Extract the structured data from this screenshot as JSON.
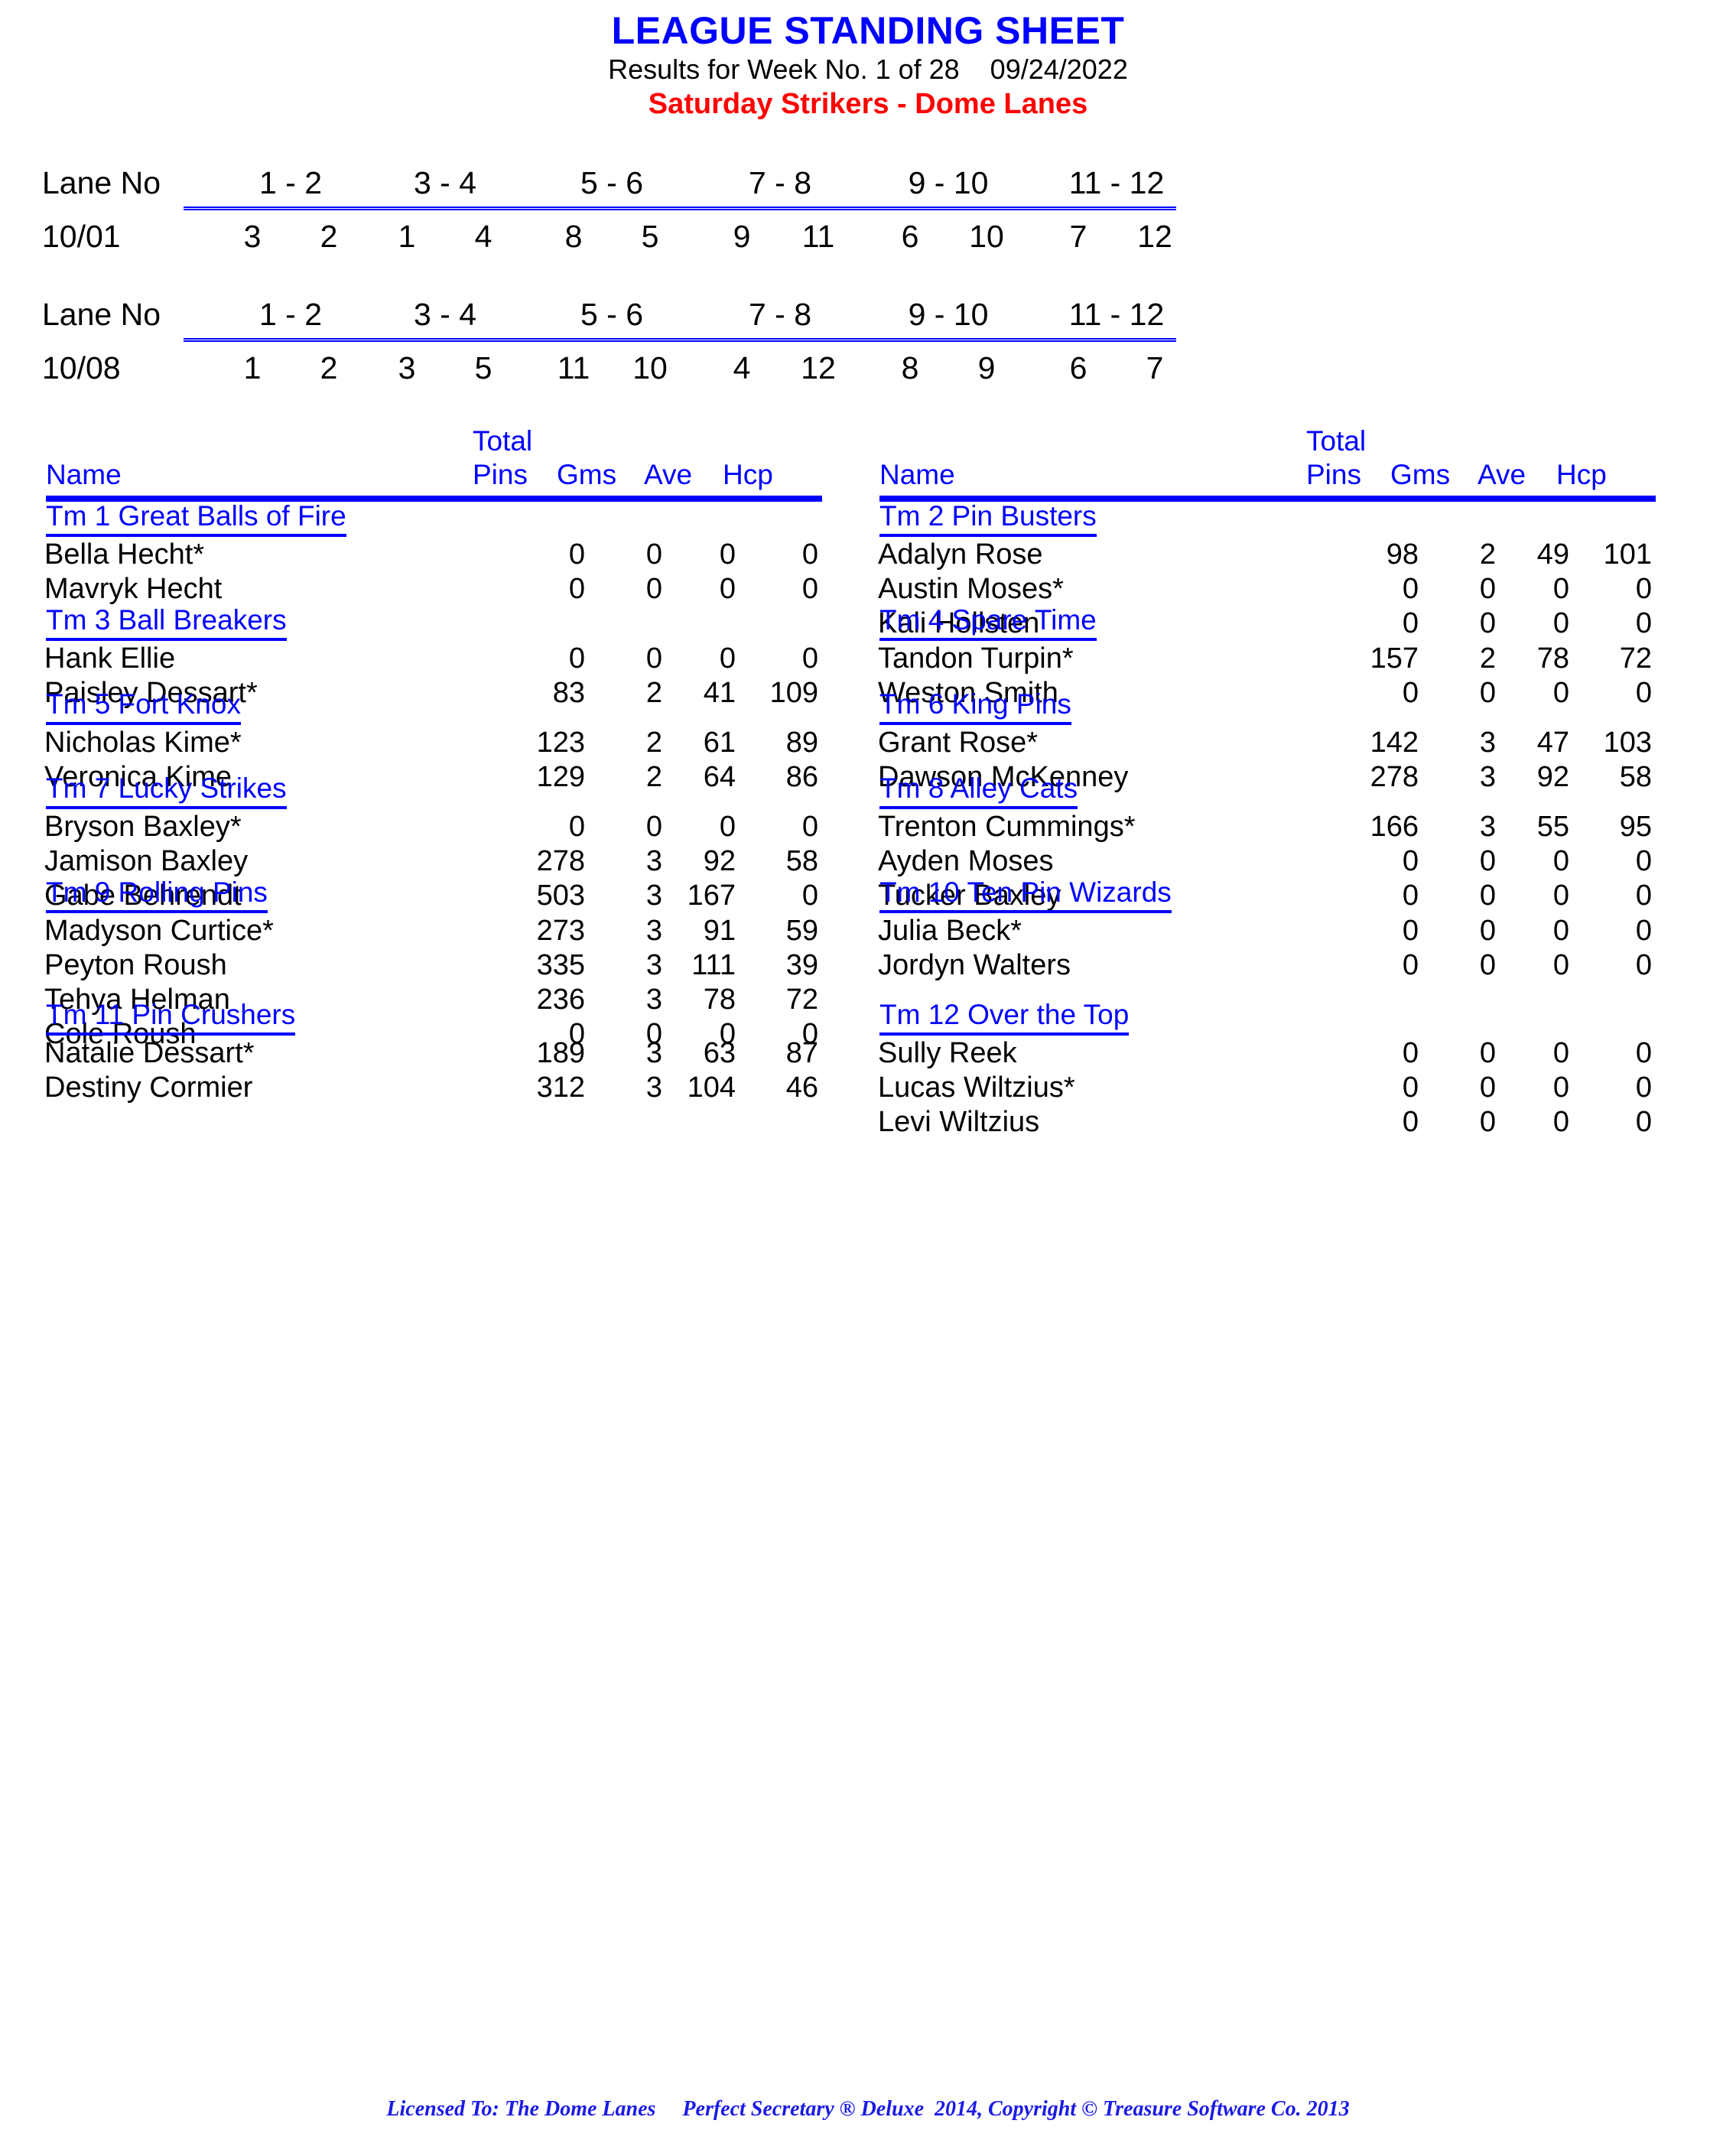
{
  "header": {
    "title": "LEAGUE STANDING SHEET",
    "subtitle": "Results for Week No. 1 of 28    09/24/2022",
    "league": "Saturday Strikers - Dome Lanes",
    "title_color": "#0000ff",
    "league_color": "#ff0000"
  },
  "lane_schedule": [
    {
      "label": "Lane No",
      "date": "10/01",
      "pairs": [
        "1 - 2",
        "3 - 4",
        "5 - 6",
        "7 - 8",
        "9 - 10",
        "11 - 12"
      ],
      "teams": [
        [
          "3",
          "2"
        ],
        [
          "1",
          "4"
        ],
        [
          "8",
          "5"
        ],
        [
          "9",
          "11"
        ],
        [
          "6",
          "10"
        ],
        [
          "7",
          "12"
        ]
      ]
    },
    {
      "label": "Lane No",
      "date": "10/08",
      "pairs": [
        "1 - 2",
        "3 - 4",
        "5 - 6",
        "7 - 8",
        "9 - 10",
        "11 - 12"
      ],
      "teams": [
        [
          "1",
          "2"
        ],
        [
          "3",
          "5"
        ],
        [
          "11",
          "10"
        ],
        [
          "4",
          "12"
        ],
        [
          "8",
          "9"
        ],
        [
          "6",
          "7"
        ]
      ]
    }
  ],
  "table_headers": {
    "total": "Total",
    "name": "Name",
    "pins": "Pins",
    "gms": "Gms",
    "ave": "Ave",
    "hcp": "Hcp"
  },
  "columns": {
    "left": [
      {
        "team": "Tm 1 Great Balls of Fire",
        "players": [
          {
            "name": "Bella Hecht*",
            "pins": "0",
            "gms": "0",
            "ave": "0",
            "hcp": "0"
          },
          {
            "name": "Mavryk Hecht",
            "pins": "0",
            "gms": "0",
            "ave": "0",
            "hcp": "0"
          }
        ]
      },
      {
        "team": "Tm 3 Ball Breakers",
        "players": [
          {
            "name": "Hank Ellie",
            "pins": "0",
            "gms": "0",
            "ave": "0",
            "hcp": "0"
          },
          {
            "name": "Paisley Dessart*",
            "pins": "83",
            "gms": "2",
            "ave": "41",
            "hcp": "109"
          }
        ]
      },
      {
        "team": "Tm 5 Fort Knox",
        "players": [
          {
            "name": "Nicholas Kime*",
            "pins": "123",
            "gms": "2",
            "ave": "61",
            "hcp": "89"
          },
          {
            "name": "Veronica Kime",
            "pins": "129",
            "gms": "2",
            "ave": "64",
            "hcp": "86"
          }
        ]
      },
      {
        "team": "Tm 7 Lucky Strikes",
        "players": [
          {
            "name": "Bryson Baxley*",
            "pins": "0",
            "gms": "0",
            "ave": "0",
            "hcp": "0"
          },
          {
            "name": "Jamison Baxley",
            "pins": "278",
            "gms": "3",
            "ave": "92",
            "hcp": "58"
          },
          {
            "name": "Gabe Behrendt",
            "pins": "503",
            "gms": "3",
            "ave": "167",
            "hcp": "0"
          }
        ]
      },
      {
        "team": "Tm 9 Rolling Pins",
        "players": [
          {
            "name": "Madyson Curtice*",
            "pins": "273",
            "gms": "3",
            "ave": "91",
            "hcp": "59"
          },
          {
            "name": "Peyton Roush",
            "pins": "335",
            "gms": "3",
            "ave": "111",
            "hcp": "39"
          },
          {
            "name": "Tehya Helman",
            "pins": "236",
            "gms": "3",
            "ave": "78",
            "hcp": "72"
          },
          {
            "name": "Cole Roush",
            "pins": "0",
            "gms": "0",
            "ave": "0",
            "hcp": "0"
          }
        ]
      },
      {
        "team": "Tm 11 Pin Crushers",
        "players": [
          {
            "name": "Natalie Dessart*",
            "pins": "189",
            "gms": "3",
            "ave": "63",
            "hcp": "87"
          },
          {
            "name": "Destiny Cormier",
            "pins": "312",
            "gms": "3",
            "ave": "104",
            "hcp": "46"
          }
        ]
      }
    ],
    "right": [
      {
        "team": "Tm 2 Pin Busters",
        "players": [
          {
            "name": "Adalyn Rose",
            "pins": "98",
            "gms": "2",
            "ave": "49",
            "hcp": "101"
          },
          {
            "name": "Austin Moses*",
            "pins": "0",
            "gms": "0",
            "ave": "0",
            "hcp": "0"
          },
          {
            "name": "Kali Hollsten",
            "pins": "0",
            "gms": "0",
            "ave": "0",
            "hcp": "0"
          }
        ]
      },
      {
        "team": "Tm 4 Spare Time",
        "players": [
          {
            "name": "Tandon Turpin*",
            "pins": "157",
            "gms": "2",
            "ave": "78",
            "hcp": "72"
          },
          {
            "name": "Weston Smith",
            "pins": "0",
            "gms": "0",
            "ave": "0",
            "hcp": "0"
          }
        ]
      },
      {
        "team": "Tm 6 King Pins",
        "players": [
          {
            "name": "Grant Rose*",
            "pins": "142",
            "gms": "3",
            "ave": "47",
            "hcp": "103"
          },
          {
            "name": "Dawson McKenney",
            "pins": "278",
            "gms": "3",
            "ave": "92",
            "hcp": "58"
          }
        ]
      },
      {
        "team": "Tm 8 Alley Cats",
        "players": [
          {
            "name": "Trenton Cummings*",
            "pins": "166",
            "gms": "3",
            "ave": "55",
            "hcp": "95"
          },
          {
            "name": "Ayden Moses",
            "pins": "0",
            "gms": "0",
            "ave": "0",
            "hcp": "0"
          },
          {
            "name": "Tucker Baxley",
            "pins": "0",
            "gms": "0",
            "ave": "0",
            "hcp": "0"
          }
        ]
      },
      {
        "team": "Tm 10 Ten Pin Wizards",
        "players": [
          {
            "name": "Julia Beck*",
            "pins": "0",
            "gms": "0",
            "ave": "0",
            "hcp": "0"
          },
          {
            "name": "Jordyn Walters",
            "pins": "0",
            "gms": "0",
            "ave": "0",
            "hcp": "0"
          }
        ]
      },
      {
        "team": "Tm 12 Over the Top",
        "players": [
          {
            "name": "Sully Reek",
            "pins": "0",
            "gms": "0",
            "ave": "0",
            "hcp": "0"
          },
          {
            "name": "Lucas Wiltzius*",
            "pins": "0",
            "gms": "0",
            "ave": "0",
            "hcp": "0"
          },
          {
            "name": "Levi Wiltzius",
            "pins": "0",
            "gms": "0",
            "ave": "0",
            "hcp": "0"
          }
        ]
      }
    ]
  },
  "footer": {
    "text": "Licensed To: The Dome Lanes     Perfect Secretary ® Deluxe  2014, Copyright © Treasure Software Co. 2013",
    "color": "#1a1ae6"
  }
}
